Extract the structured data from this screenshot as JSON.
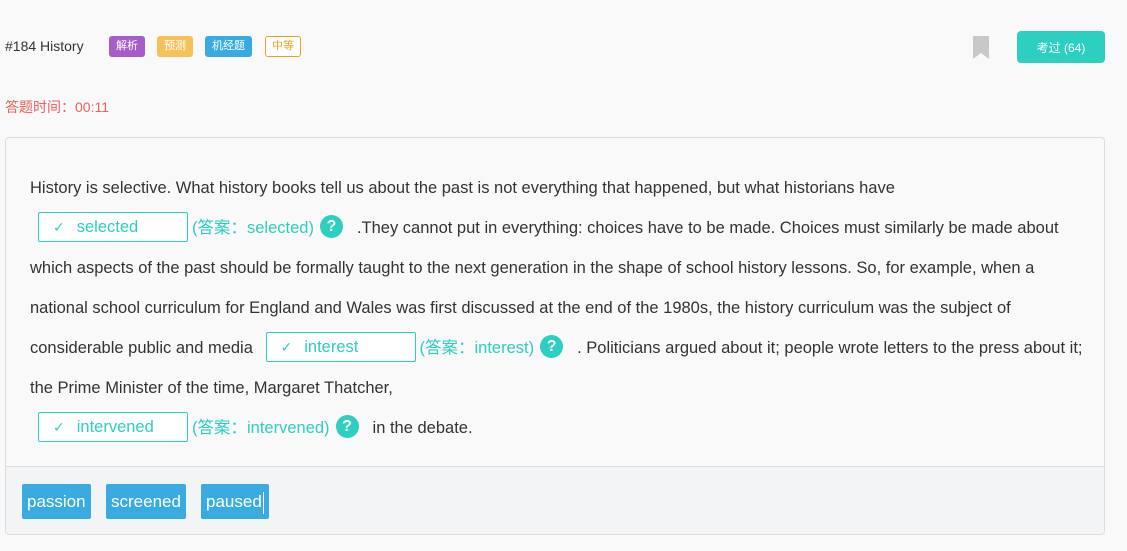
{
  "header": {
    "question_title": "#184 History",
    "badges": {
      "analysis": "解析",
      "predict": "预测",
      "machine": "机经题",
      "level": "中等"
    },
    "took_button": "考过 (64)",
    "icons": {
      "bookmark": "bookmark-icon"
    }
  },
  "timer": "答题时间：00:11",
  "passage": {
    "p1": "History is selective. What history books tell us about the past is not everything that happened, but what historians have",
    "blank1": {
      "value": "selected",
      "answer": "(答案：selected)"
    },
    "p2": ".They cannot put in everything: choices have to be made. Choices must similarly be made about which aspects of the past should be formally taught to the next generation in the shape of school history lessons. So, for example, when a national school curriculum for England and Wales was first discussed at the end of the 1980s, the history curriculum was the subject of considerable public and media",
    "blank2": {
      "value": "interest",
      "answer": "(答案：interest)"
    },
    "p3": ". Politicians argued about it; people wrote letters to the press about it; the Prime Minister of the time, Margaret Thatcher,",
    "blank3": {
      "value": "intervened",
      "answer": "(答案：intervened)"
    },
    "p4": "in the debate.",
    "check_mark": "✓",
    "help_mark": "?"
  },
  "options": [
    "passion",
    "screened",
    "paused"
  ],
  "colors": {
    "accent": "#2ccfc0",
    "option": "#39abe0",
    "timer": "#e8615c"
  }
}
